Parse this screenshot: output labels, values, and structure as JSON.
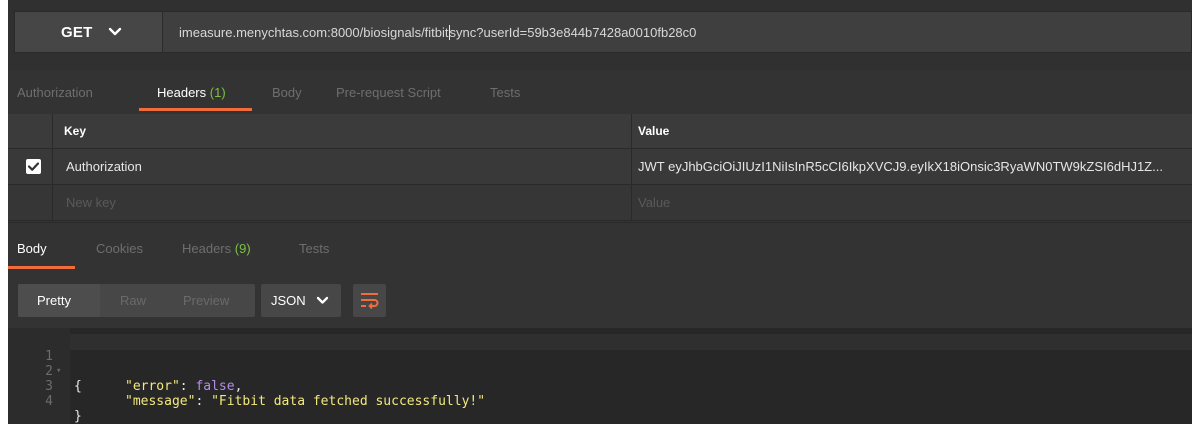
{
  "request": {
    "method": "GET",
    "url_before_cursor": "imeasure.menychtas.com:8000/biosignals/fitbit",
    "url_after_cursor": "sync?userId=59b3e844b7428a0010fb28c0"
  },
  "request_tabs": [
    {
      "label": "Authorization",
      "count": ""
    },
    {
      "label": "Headers",
      "count": "(1)"
    },
    {
      "label": "Body",
      "count": ""
    },
    {
      "label": "Pre-request Script",
      "count": ""
    },
    {
      "label": "Tests",
      "count": ""
    }
  ],
  "active_request_tab": "Headers",
  "headers_table": {
    "columns": {
      "key": "Key",
      "value": "Value"
    },
    "rows": [
      {
        "checked": true,
        "key": "Authorization",
        "value": "JWT eyJhbGciOiJIUzI1NiIsInR5cCI6IkpXVCJ9.eyIkX18iOnsic3RyaWN0TW9kZSI6dHJ1Z..."
      }
    ],
    "new_row": {
      "key_placeholder": "New key",
      "value_placeholder": "Value"
    }
  },
  "response_tabs": [
    {
      "label": "Body",
      "count": ""
    },
    {
      "label": "Cookies",
      "count": ""
    },
    {
      "label": "Headers",
      "count": "(9)"
    },
    {
      "label": "Tests",
      "count": ""
    }
  ],
  "active_response_tab": "Body",
  "view_modes": [
    "Pretty",
    "Raw",
    "Preview"
  ],
  "active_view_mode": "Pretty",
  "format": "JSON",
  "code_lines": [
    {
      "n": "1",
      "text": "{"
    },
    {
      "n": "2",
      "key": "\"error\"",
      "sep": ": ",
      "val": "false",
      "tail": ","
    },
    {
      "n": "3",
      "key": "\"message\"",
      "sep": ": ",
      "str": "\"Fitbit data fetched successfully!\"",
      "tail": ""
    },
    {
      "n": "4",
      "text": "}"
    }
  ],
  "colors": {
    "accent_orange": "#f26b3a",
    "count_green": "#7ac143",
    "json_key": "#f3e97c",
    "json_boolean": "#b48ce8"
  },
  "icons": {
    "method_caret": "chevron-down-icon",
    "format_caret": "chevron-down-icon",
    "wrap": "wrap-lines-icon",
    "check": "check-icon",
    "fold": "fold-caret-icon"
  }
}
